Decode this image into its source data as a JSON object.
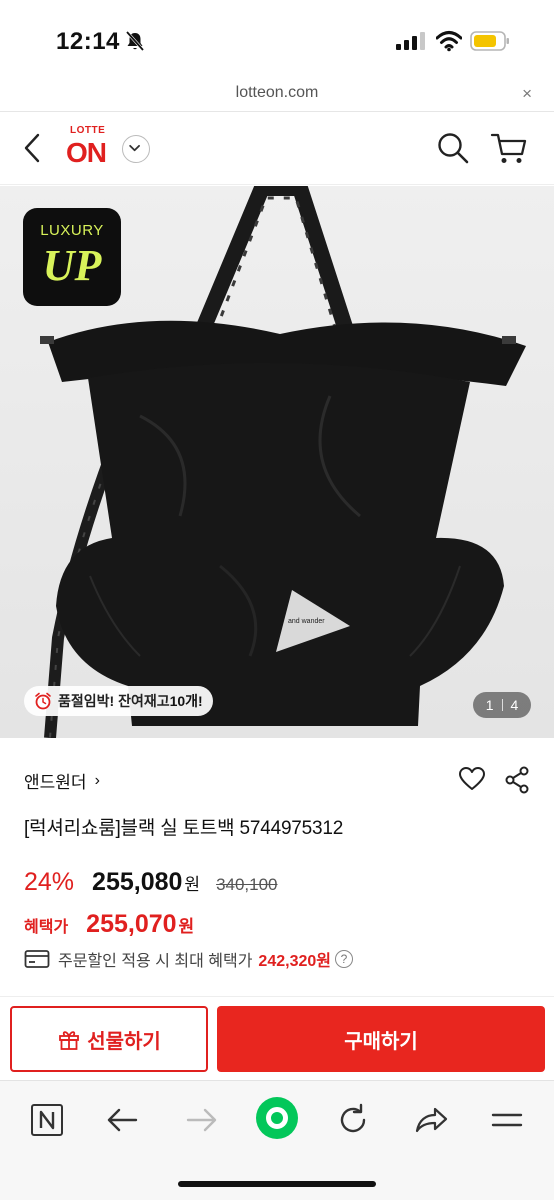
{
  "status_bar": {
    "time": "12:14"
  },
  "browser": {
    "url": "lotteon.com",
    "close_label": "×"
  },
  "site": {
    "logo_top": "LOTTE",
    "logo_main": "ON"
  },
  "product_image": {
    "badge_top": "LUXURY",
    "badge_main": "UP",
    "bag_brand_print": "and wander",
    "stock_text": "품절임박! 잔여재고 ",
    "stock_count": "10개!",
    "pager_current": "1",
    "pager_total": "4"
  },
  "product": {
    "brand": "앤드원더",
    "brand_arrow": "›",
    "title": "[럭셔리쇼룸]블랙 실 토트백 5744975312",
    "discount": "24%",
    "price": "255,080",
    "currency": "원",
    "original_price": "340,100",
    "benefit_label": "혜택가",
    "benefit_price": "255,070",
    "max_benefit_text": "주문할인 적용 시 최대 혜택가",
    "max_benefit_price": "242,320원",
    "help_label": "?"
  },
  "actions": {
    "gift_label": "선물하기",
    "buy_label": "구매하기"
  },
  "colors": {
    "accent": "#e0201f",
    "buy_button": "#e8261f",
    "naver_green": "#03c75a"
  }
}
